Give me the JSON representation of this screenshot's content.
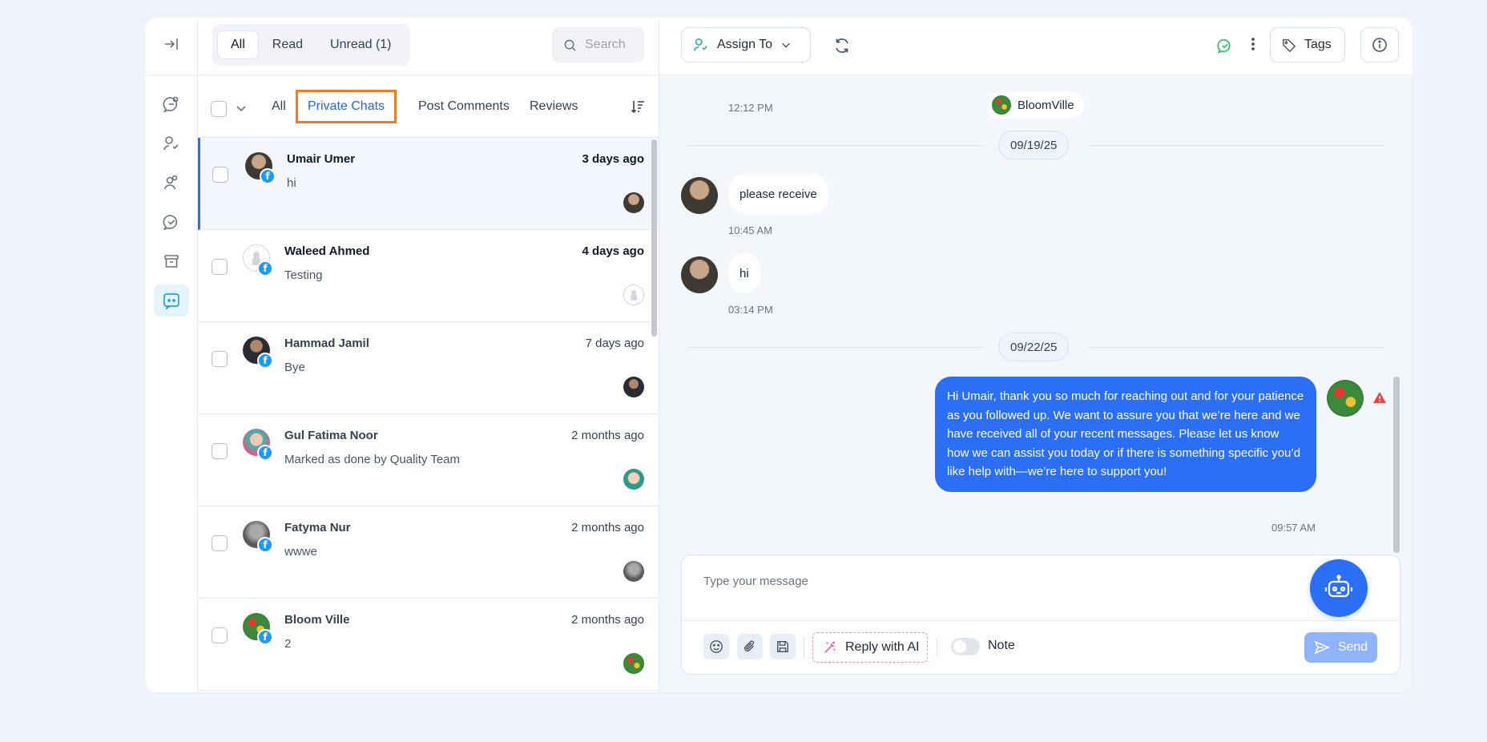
{
  "header": {
    "filters": [
      {
        "label": "All",
        "active": true
      },
      {
        "label": "Read",
        "active": false
      },
      {
        "label": "Unread (1)",
        "active": false
      }
    ],
    "search_placeholder": "Search"
  },
  "tabs": [
    {
      "label": "All",
      "active": false
    },
    {
      "label": "Private Chats",
      "active": true
    },
    {
      "label": "Post Comments",
      "active": false
    },
    {
      "label": "Reviews",
      "active": false
    }
  ],
  "conversations": [
    {
      "name": "Umair Umer",
      "time": "3 days ago",
      "message": "hi",
      "unread": true,
      "selected": true
    },
    {
      "name": "Waleed Ahmed",
      "time": "4 days ago",
      "message": "Testing",
      "unread": true,
      "selected": false
    },
    {
      "name": "Hammad Jamil",
      "time": "7 days ago",
      "message": "Bye",
      "unread": false,
      "selected": false
    },
    {
      "name": "Gul Fatima Noor",
      "time": "2 months ago",
      "message": "Marked as done by Quality Team",
      "unread": false,
      "selected": false
    },
    {
      "name": "Fatyma Nur",
      "time": "2 months ago",
      "message": "wwwe",
      "unread": false,
      "selected": false
    },
    {
      "name": "Bloom Ville",
      "time": "2 months ago",
      "message": "2",
      "unread": false,
      "selected": false
    }
  ],
  "chat_header": {
    "assign_label": "Assign To",
    "tags_label": "Tags"
  },
  "chat": {
    "page_name": "BloomVille",
    "first_time": "12:12 PM",
    "dates": [
      "09/19/25",
      "09/22/25"
    ],
    "incoming": [
      {
        "text": "please receive",
        "time": "10:45 AM"
      },
      {
        "text": "hi",
        "time": "03:14 PM"
      }
    ],
    "outgoing": {
      "text": "Hi Umair, thank you so much for reaching out and for your patience as you followed up. We want to assure you that we’re here and we have received all of your recent messages. Please let us know how we can assist you today or if there is something specific you’d like help with—we’re here to support you!",
      "time": "09:57 AM"
    }
  },
  "composer": {
    "placeholder": "Type your message",
    "ai_label": "Reply with AI",
    "note_label": "Note",
    "send_label": "Send"
  },
  "colors": {
    "accent": "#2b6ff6",
    "highlight_border": "#f07b24",
    "facebook": "#1b9af7",
    "warning": "#ef4444",
    "online": "#22c55e"
  }
}
